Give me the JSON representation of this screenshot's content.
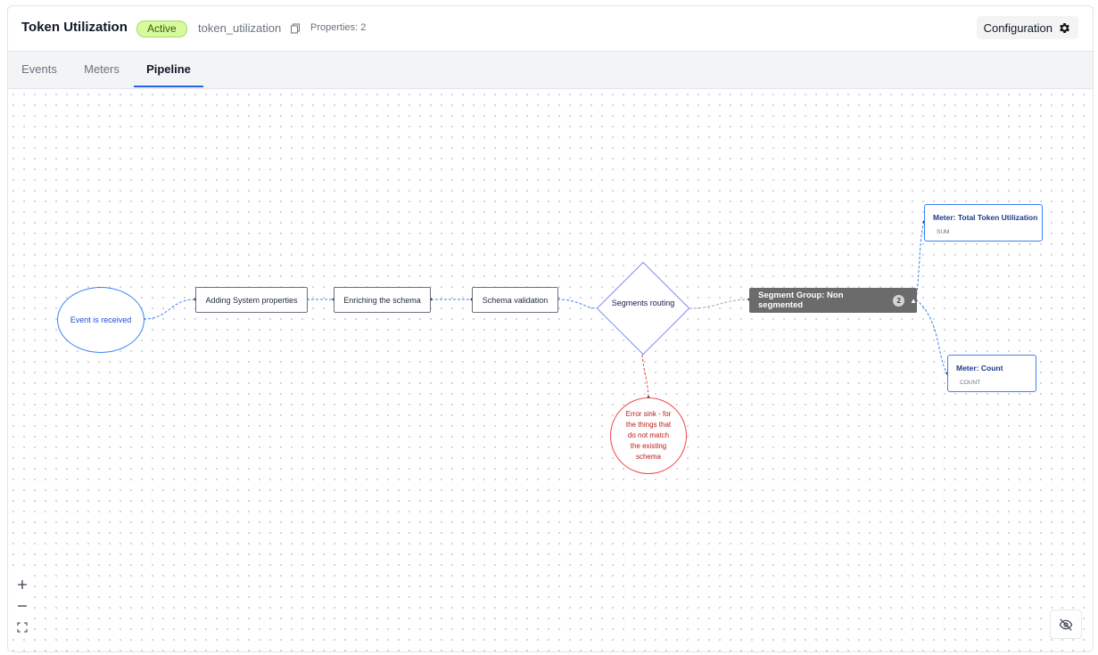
{
  "header": {
    "title": "Token Utilization",
    "status": "Active",
    "slug": "token_utilization",
    "properties": "Properties: 2",
    "config_label": "Configuration"
  },
  "tabs": [
    {
      "label": "Events"
    },
    {
      "label": "Meters"
    },
    {
      "label": "Pipeline"
    }
  ],
  "pipeline": {
    "event_node": "Event is received",
    "step1": "Adding System properties",
    "step2": "Enriching the schema",
    "step3": "Schema validation",
    "router": "Segments routing",
    "error_sink": "Error sink - for the things that do not match the existing schema",
    "segment_group": "Segment Group: Non segmented",
    "segment_count": "2",
    "meters": [
      {
        "title": "Meter: Total Token Utilization",
        "agg": "SUM"
      },
      {
        "title": "Meter: Count",
        "agg": "COUNT"
      }
    ]
  },
  "colors": {
    "accent": "#2563eb",
    "badge_bg": "#d9f99d",
    "error": "#ef4444",
    "segment_bg": "#6b6b6b"
  }
}
